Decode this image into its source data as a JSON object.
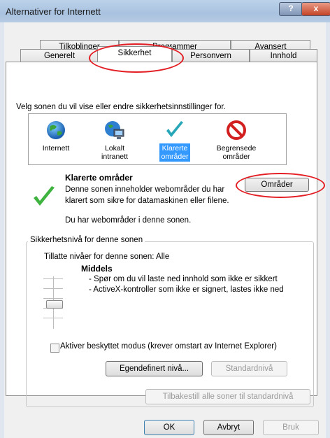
{
  "window": {
    "title": "Alternativer for Internett",
    "help_glyph": "?",
    "close_glyph": "x"
  },
  "tabs": {
    "back_row": [
      "Tilkoblinger",
      "Programmer",
      "Avansert"
    ],
    "front_row": [
      "Generelt",
      "Sikkerhet",
      "Personvern",
      "Innhold"
    ],
    "active": "Sikkerhet"
  },
  "security": {
    "instruction": "Velg sonen du vil vise eller endre sikkerhetsinnstillinger for.",
    "zones": [
      {
        "line1": "Internett",
        "line2": "",
        "icon": "globe-icon",
        "selected": false
      },
      {
        "line1": "Lokalt",
        "line2": "intranett",
        "icon": "intranet-icon",
        "selected": false
      },
      {
        "line1": "Klarerte",
        "line2": "områder",
        "icon": "checkmark-icon",
        "selected": true
      },
      {
        "line1": "Begrensede",
        "line2": "områder",
        "icon": "no-entry-icon",
        "selected": false
      }
    ],
    "zone_title": "Klarerte områder",
    "zone_desc_line1": "Denne sonen inneholder webområder du har",
    "zone_desc_line2": "klarert som sikre for datamaskinen eller filene.",
    "sites_button": "Områder",
    "sites_status": "Du har webområder i denne sonen."
  },
  "level": {
    "group_label": "Sikkerhetsnivå for denne sonen",
    "allowed": "Tillatte nivåer for denne sonen: Alle",
    "name": "Middels",
    "bullet1": "- Spør om du vil laste ned innhold som ikke er sikkert",
    "bullet2": "- ActiveX-kontroller som ikke er signert, lastes ikke ned",
    "protected_mode": "Aktiver beskyttet modus (krever omstart av Internet Explorer)",
    "custom_button": "Egendefinert nivå...",
    "default_button": "Standardnivå",
    "reset_all_button": "Tilbakestill alle soner til standardnivå"
  },
  "footer": {
    "ok": "OK",
    "cancel": "Avbryt",
    "apply": "Bruk"
  },
  "colors": {
    "highlight_ellipse": "#e31e24",
    "selection": "#3399ff"
  }
}
